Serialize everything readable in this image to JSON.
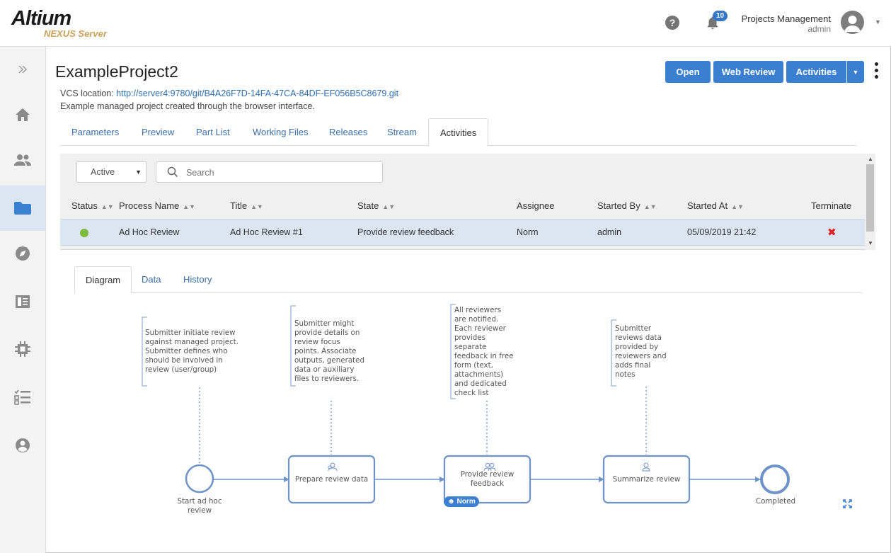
{
  "header": {
    "logo": "Altium",
    "logo_sub": "NEXUS Server",
    "notification_count": "10",
    "user_title": "Projects Management",
    "user_name": "admin"
  },
  "sidebar": {
    "items": [
      {
        "icon": "expand-icon"
      },
      {
        "icon": "home-icon"
      },
      {
        "icon": "team-icon"
      },
      {
        "icon": "folder-icon",
        "active": true
      },
      {
        "icon": "compass-icon"
      },
      {
        "icon": "book-icon"
      },
      {
        "icon": "chip-icon"
      },
      {
        "icon": "checklist-icon"
      },
      {
        "icon": "account-icon"
      }
    ]
  },
  "project": {
    "title": "ExampleProject2",
    "vcs_label": "VCS location:",
    "vcs_url": "http://server4:9780/git/B4A26F7D-14FA-47CA-84DF-EF056B5C8679.git",
    "description": "Example managed project created through the browser interface."
  },
  "toolbar": {
    "open": "Open",
    "web_review": "Web Review",
    "activities": "Activities"
  },
  "tabs": [
    "Parameters",
    "Preview",
    "Part List",
    "Working Files",
    "Releases",
    "Stream",
    "Activities"
  ],
  "active_tab": "Activities",
  "activities": {
    "filter_value": "Active",
    "search_placeholder": "Search",
    "columns": [
      "Status",
      "Process Name",
      "Title",
      "State",
      "Assignee",
      "Started By",
      "Started At",
      "Terminate"
    ],
    "rows": [
      {
        "status_color": "#7cbb3b",
        "process_name": "Ad Hoc Review",
        "title": "Ad Hoc Review #1",
        "state": "Provide review feedback",
        "assignee": "Norm",
        "started_by": "admin",
        "started_at": "05/09/2019 21:42"
      }
    ]
  },
  "subtabs": [
    "Diagram",
    "Data",
    "History"
  ],
  "active_subtab": "Diagram",
  "diagram": {
    "annotations": [
      [
        "Submitter initiate review",
        "against managed project.",
        "Submitter defines who",
        "should be involved in",
        "review (user/group)"
      ],
      [
        "Submitter might",
        "provide details on",
        "review focus",
        "points. Associate",
        "outputs, generated",
        "data or auxiliary",
        "files to reviewers."
      ],
      [
        "All reviewers",
        "are notified.",
        "Each reviewer",
        "provides",
        "separate",
        "feedback in free",
        "form (text,",
        "attachments)",
        "and dedicated",
        "check list"
      ],
      [
        "Submitter",
        "reviews data",
        "provided by",
        "reviewers and",
        "adds final",
        "notes"
      ]
    ],
    "start_label": [
      "Start ad hoc",
      "review"
    ],
    "tasks": [
      [
        "Prepare review data"
      ],
      [
        "Provide review",
        "feedback"
      ],
      [
        "Summarize review"
      ]
    ],
    "end_label": "Completed",
    "assignee_badge": "Norm"
  },
  "colors": {
    "accent": "#3b7fd0",
    "link": "#2f6fb0",
    "diagram_stroke": "#6e93c9",
    "status_active": "#7cbb3b",
    "terminate": "#dd2222"
  }
}
